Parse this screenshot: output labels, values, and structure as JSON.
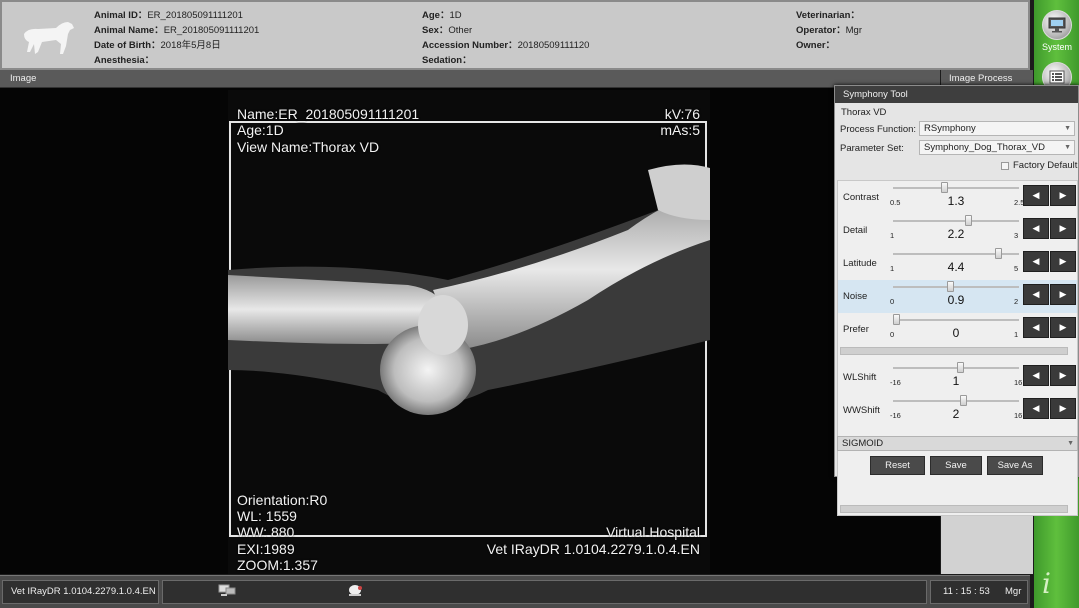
{
  "header": {
    "animal_id_label": "Animal ID：",
    "animal_id": "ER_201805091111201",
    "animal_name_label": "Animal Name：",
    "animal_name": "ER_201805091111201",
    "dob_label": "Date of Birth：",
    "dob": "2018年5月8日",
    "anesthesia_label": "Anesthesia：",
    "anesthesia": "",
    "age_label": "Age：",
    "age": "1D",
    "sex_label": "Sex：",
    "sex": "Other",
    "accession_label": "Accession Number：",
    "accession": "20180509111120",
    "sedation_label": "Sedation：",
    "sedation": "",
    "vet_label": "Veterinarian：",
    "vet": "",
    "operator_label": "Operator：",
    "operator": "Mgr",
    "owner_label": "Owner：",
    "owner": ""
  },
  "rail": {
    "system_label": "System"
  },
  "panels": {
    "image_title": "Image",
    "image_process_title": "Image Process"
  },
  "overlay": {
    "name": "Name:ER_201805091111201",
    "age": "Age:1D",
    "view": "View Name:Thorax VD",
    "kv": "kV:76",
    "mas": "mAs:5",
    "orientation": "Orientation:R0",
    "wl": "WL: 1559",
    "ww": "WW: 880",
    "exi": "EXI:1989",
    "zoom": "ZOOM:1.357",
    "hospital": "Virtual Hospital",
    "version": "Vet IRayDR 1.0104.2279.1.0.4.EN"
  },
  "status": {
    "version": "Vet IRayDR 1.0104.2279.1.0.4.EN",
    "time": "11 : 15 : 53",
    "user": "Mgr"
  },
  "symphony": {
    "title": "Symphony Tool",
    "subtitle": "Thorax VD",
    "process_label": "Process Function:",
    "process_value": "RSymphony",
    "param_label": "Parameter Set:",
    "param_value": "Symphony_Dog_Thorax_VD",
    "factory_label": "Factory Default",
    "sigmoid": "SIGMOID",
    "reset": "Reset",
    "save": "Save",
    "save_as": "Save As",
    "sliders": [
      {
        "name": "Contrast",
        "min": "0.5",
        "max": "2.5",
        "value": "1.3",
        "fraction": 0.4
      },
      {
        "name": "Detail",
        "min": "1",
        "max": "3",
        "value": "2.2",
        "fraction": 0.6
      },
      {
        "name": "Latitude",
        "min": "1",
        "max": "5",
        "value": "4.4",
        "fraction": 0.85
      },
      {
        "name": "Noise",
        "min": "0",
        "max": "2",
        "value": "0.9",
        "fraction": 0.45
      },
      {
        "name": "Prefer",
        "min": "0",
        "max": "1",
        "value": "0",
        "fraction": 0.0
      },
      {
        "name": "WLShift",
        "min": "-16",
        "max": "16",
        "value": "1",
        "fraction": 0.53
      },
      {
        "name": "WWShift",
        "min": "-16",
        "max": "16",
        "value": "2",
        "fraction": 0.56
      }
    ]
  }
}
